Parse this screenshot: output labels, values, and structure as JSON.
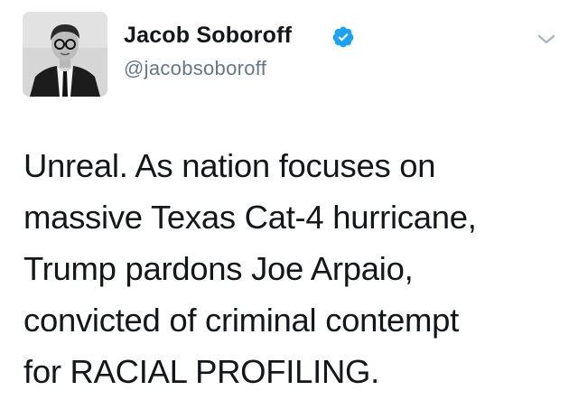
{
  "tweet": {
    "author": {
      "name": "Jacob Soboroff",
      "handle": "@jacobsoboroff",
      "verified_icon": "verified-badge-icon",
      "avatar_icon": "avatar-photo"
    },
    "menu_icon": "chevron-down-icon",
    "text_lines": [
      "Unreal. As nation focuses on",
      "massive Texas Cat-4 hurricane,",
      "Trump pardons Joe Arpaio,",
      "convicted of criminal contempt",
      "for RACIAL PROFILING."
    ]
  },
  "colors": {
    "text": "#14171a",
    "secondary": "#657786",
    "verified_blue": "#1da1f2",
    "chevron": "#aab8c2"
  }
}
